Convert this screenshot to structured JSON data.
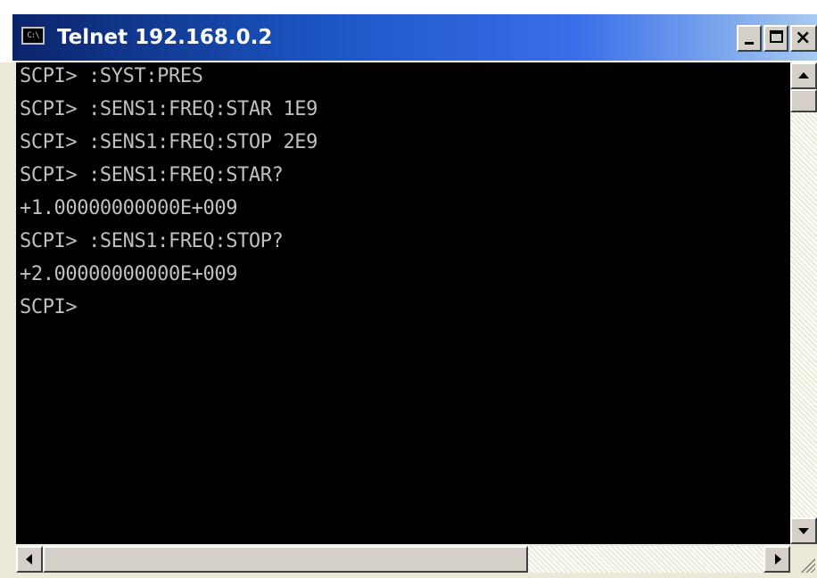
{
  "window": {
    "title": "Telnet 192.168.0.2",
    "icon_label": "C:\\",
    "close_glyph": "×"
  },
  "console": {
    "lines": [
      "SCPI> :SYST:PRES",
      "SCPI> :SENS1:FREQ:STAR 1E9",
      "SCPI> :SENS1:FREQ:STOP 2E9",
      "SCPI> :SENS1:FREQ:STAR?",
      "+1.00000000000E+009",
      "SCPI> :SENS1:FREQ:STOP?",
      "+2.00000000000E+009",
      "SCPI>"
    ],
    "foreground_color": "#c0c0c0",
    "background_color": "#000000"
  },
  "titlebar_colors": {
    "start": "#0a246a",
    "end": "#a6caf0"
  }
}
